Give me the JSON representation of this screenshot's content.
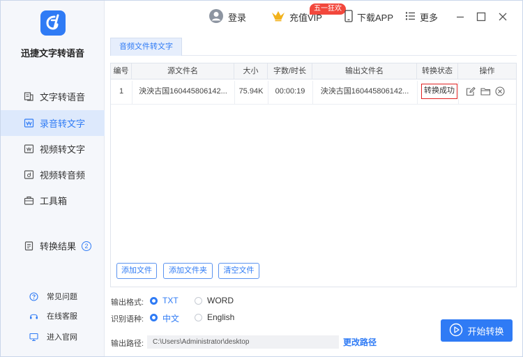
{
  "app": {
    "name": "迅捷文字转语音"
  },
  "sidebar": {
    "items": [
      {
        "label": "文字转语音",
        "icon": "text-speech-icon"
      },
      {
        "label": "录音转文字",
        "icon": "record-text-icon"
      },
      {
        "label": "视频转文字",
        "icon": "video-text-icon"
      },
      {
        "label": "视频转音频",
        "icon": "video-audio-icon"
      },
      {
        "label": "工具箱",
        "icon": "toolbox-icon"
      }
    ],
    "results": {
      "label": "转换结果",
      "count": "2"
    },
    "footer": [
      {
        "label": "常见问题",
        "icon": "question-icon"
      },
      {
        "label": "在线客服",
        "icon": "headset-icon"
      },
      {
        "label": "进入官网",
        "icon": "monitor-icon"
      }
    ]
  },
  "topbar": {
    "login": "登录",
    "vip": "充值VIP",
    "vip_badge": "五一狂欢",
    "download": "下载APP",
    "more": "更多"
  },
  "tabs": [
    "音频文件转文字"
  ],
  "table": {
    "headers": [
      "编号",
      "源文件名",
      "大小",
      "字数/时长",
      "输出文件名",
      "转换状态",
      "操作"
    ],
    "rows": [
      {
        "index": "1",
        "source": "泱泱古国160445806142...",
        "size": "75.94K",
        "duration": "00:00:19",
        "output": "泱泱古国160445806142...",
        "status": "转换成功"
      }
    ]
  },
  "buttons": {
    "add_file": "添加文件",
    "add_folder": "添加文件夹",
    "clear": "清空文件",
    "start": "开始转换",
    "change_path": "更改路径"
  },
  "settings": {
    "format_label": "输出格式:",
    "format_options": [
      "TXT",
      "WORD"
    ],
    "format_selected": "TXT",
    "lang_label": "识别语种:",
    "lang_options": [
      "中文",
      "English"
    ],
    "lang_selected": "中文",
    "path_label": "输出路径:",
    "path_value": "C:\\Users\\Administrator\\desktop"
  },
  "colors": {
    "accent": "#2f7bf5",
    "badge": "#f2473c",
    "status_border": "#e02020"
  }
}
